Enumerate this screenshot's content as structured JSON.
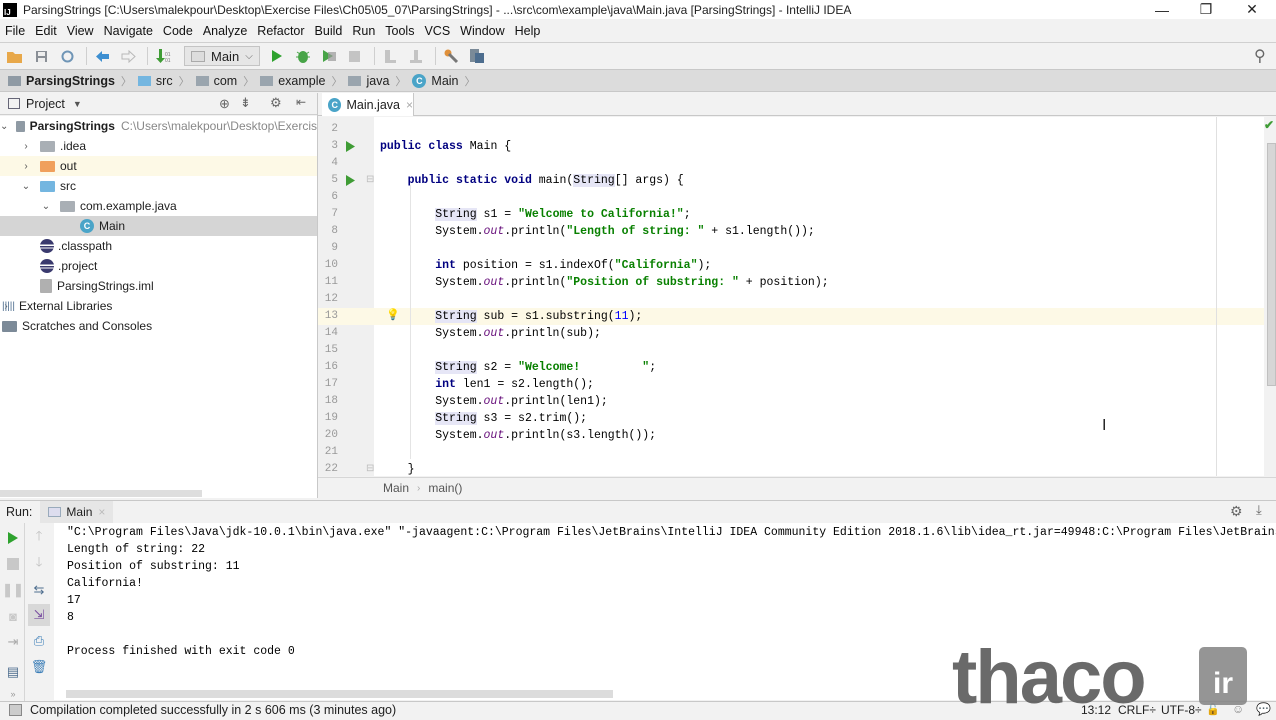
{
  "window": {
    "title": "ParsingStrings [C:\\Users\\malekpour\\Desktop\\Exercise Files\\Ch05\\05_07\\ParsingStrings] - ...\\src\\com\\example\\java\\Main.java [ParsingStrings] - IntelliJ IDEA",
    "logo": "IJ",
    "minimize": "—",
    "restore": "❐",
    "close": "✕"
  },
  "menu": [
    "File",
    "Edit",
    "View",
    "Navigate",
    "Code",
    "Analyze",
    "Refactor",
    "Build",
    "Run",
    "Tools",
    "VCS",
    "Window",
    "Help"
  ],
  "toolbar": {
    "run_config": "Main",
    "icons": [
      "open-folder-icon",
      "save-icon",
      "sync-icon",
      "back-icon",
      "forward-icon",
      "build-icon",
      "run-icon",
      "debug-icon",
      "coverage-icon",
      "stop-icon",
      "structure-icon",
      "sdk-icon",
      "settings-wrench-icon",
      "project-structure-icon"
    ]
  },
  "breadcrumbs": [
    "ParsingStrings",
    "src",
    "com",
    "example",
    "java",
    "Main"
  ],
  "project_panel": {
    "title": "Project",
    "tree": [
      {
        "label": "ParsingStrings",
        "path": "C:\\Users\\malekpour\\Desktop\\Exercis",
        "level": 0,
        "arrow": "⌄",
        "icon": "module",
        "bold": true
      },
      {
        "label": ".idea",
        "level": 1,
        "arrow": "›",
        "icon": "grey"
      },
      {
        "label": "out",
        "level": 1,
        "arrow": "›",
        "icon": "orange"
      },
      {
        "label": "src",
        "level": 1,
        "arrow": "⌄",
        "icon": "blue"
      },
      {
        "label": "com.example.java",
        "level": 2,
        "arrow": "⌄",
        "icon": "grey"
      },
      {
        "label": "Main",
        "level": 3,
        "arrow": "",
        "icon": "class",
        "selected": true
      },
      {
        "label": ".classpath",
        "level": 1,
        "arrow": "",
        "icon": "eclipse"
      },
      {
        "label": ".project",
        "level": 1,
        "arrow": "",
        "icon": "eclipse"
      },
      {
        "label": "ParsingStrings.iml",
        "level": 1,
        "arrow": "",
        "icon": "iml"
      },
      {
        "label": "External Libraries",
        "level": 0,
        "arrow": "›",
        "icon": "lib"
      },
      {
        "label": "Scratches and Consoles",
        "level": 0,
        "arrow": "",
        "icon": "scratch"
      }
    ]
  },
  "editor": {
    "tab": "Main.java",
    "tab_close": "×",
    "lines": [
      {
        "n": "2",
        "code": ""
      },
      {
        "n": "3",
        "code": "public class Main {",
        "run": true
      },
      {
        "n": "4",
        "code": ""
      },
      {
        "n": "5",
        "code": "    public static void main(String[] args) {",
        "run": true
      },
      {
        "n": "6",
        "code": ""
      },
      {
        "n": "7",
        "code": "        String s1 = \"Welcome to California!\";"
      },
      {
        "n": "8",
        "code": "        System.out.println(\"Length of string: \" + s1.length());"
      },
      {
        "n": "9",
        "code": ""
      },
      {
        "n": "10",
        "code": "        int position = s1.indexOf(\"California\");"
      },
      {
        "n": "11",
        "code": "        System.out.println(\"Position of substring: \" + position);"
      },
      {
        "n": "12",
        "code": ""
      },
      {
        "n": "13",
        "code": "        String sub = s1.substring(11);",
        "current": true
      },
      {
        "n": "14",
        "code": "        System.out.println(sub);"
      },
      {
        "n": "15",
        "code": ""
      },
      {
        "n": "16",
        "code": "        String s2 = \"Welcome!         \";"
      },
      {
        "n": "17",
        "code": "        int len1 = s2.length();"
      },
      {
        "n": "18",
        "code": "        System.out.println(len1);"
      },
      {
        "n": "19",
        "code": "        String s3 = s2.trim();"
      },
      {
        "n": "20",
        "code": "        System.out.println(s3.length());"
      },
      {
        "n": "21",
        "code": ""
      },
      {
        "n": "22",
        "code": "    }"
      }
    ],
    "breadcrumb": [
      "Main",
      "main()"
    ],
    "breadcrumb_sep": "›"
  },
  "run_panel": {
    "label": "Run:",
    "tab": "Main",
    "tab_close": "×",
    "output": [
      "\"C:\\Program Files\\Java\\jdk-10.0.1\\bin\\java.exe\" \"-javaagent:C:\\Program Files\\JetBrains\\IntelliJ IDEA Community Edition 2018.1.6\\lib\\idea_rt.jar=49948:C:\\Program Files\\JetBrains",
      "Length of string: 22",
      "Position of substring: 11",
      "California!",
      "17",
      "8",
      "",
      "Process finished with exit code 0"
    ]
  },
  "status_bar": {
    "message": "Compilation completed successfully in 2 s 606 ms (3 minutes ago)",
    "position": "13:12",
    "line_sep": "CRLF÷",
    "encoding": "UTF-8÷"
  },
  "watermark": {
    "text": "thaco",
    "badge": "ir"
  },
  "colors": {
    "keyword": "#000080",
    "string": "#088000",
    "field": "#660e7a",
    "current_line": "#fdf9e6",
    "run_green": "#3f9c35"
  }
}
